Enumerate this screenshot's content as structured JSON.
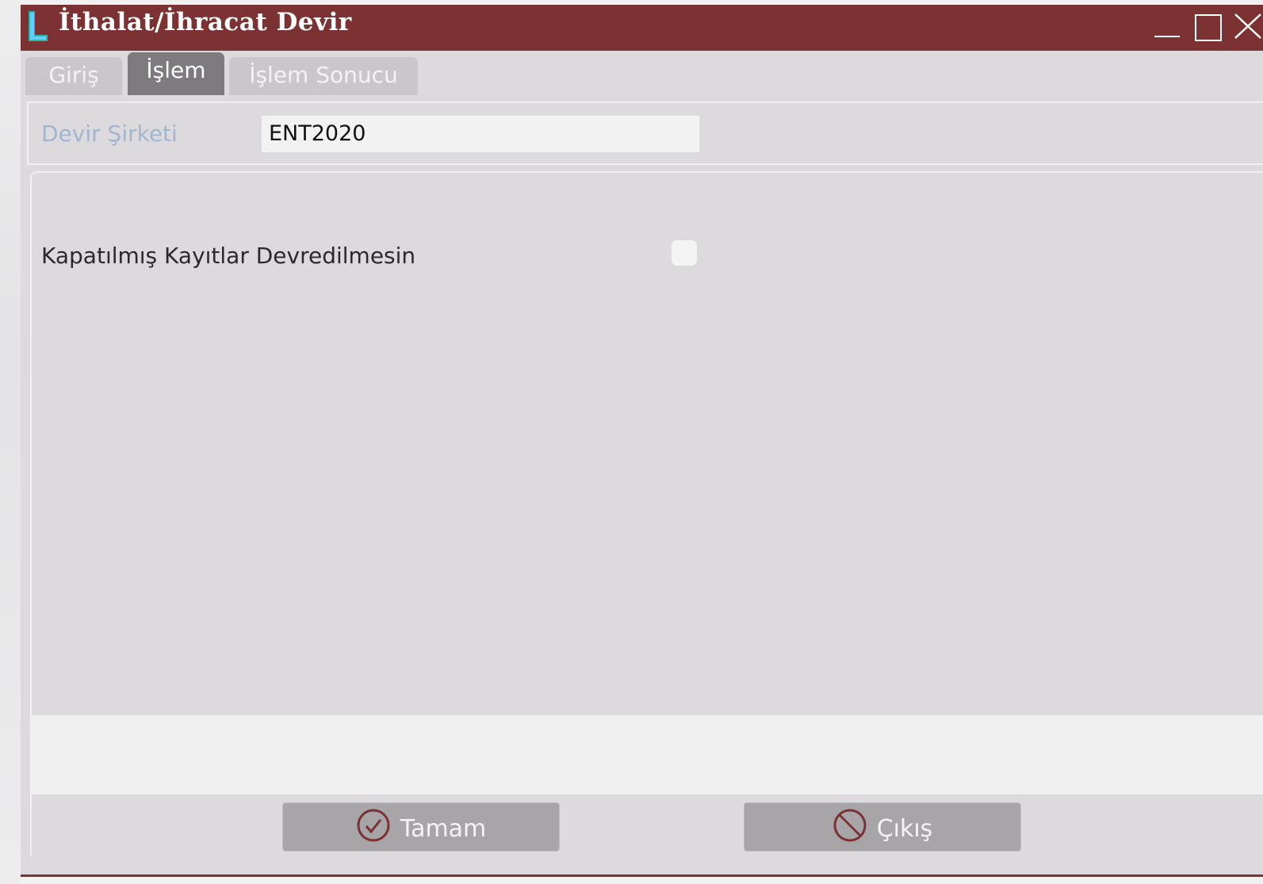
{
  "window": {
    "title": "İthalat/İhracat Devir",
    "title_color": "#7c3232"
  },
  "tabs": [
    {
      "label": "Giriş",
      "active": false
    },
    {
      "label": "İşlem",
      "active": true
    },
    {
      "label": "İşlem Sonucu",
      "active": false
    }
  ],
  "header": {
    "devir_label": "Devir Şirketi",
    "devir_value": "ENT2020"
  },
  "options": {
    "kapatilmis_label": "Kapatılmış Kayıtlar Devredilmesin",
    "kapatilmis_checked": false
  },
  "buttons": {
    "ok_label": "Tamam",
    "exit_label": "Çıkış"
  },
  "icons": {
    "app": "logo-l-icon",
    "ok": "check-circle-icon",
    "exit": "no-entry-icon",
    "minimize": "minimize-icon",
    "maximize": "maximize-icon",
    "close": "close-icon"
  }
}
